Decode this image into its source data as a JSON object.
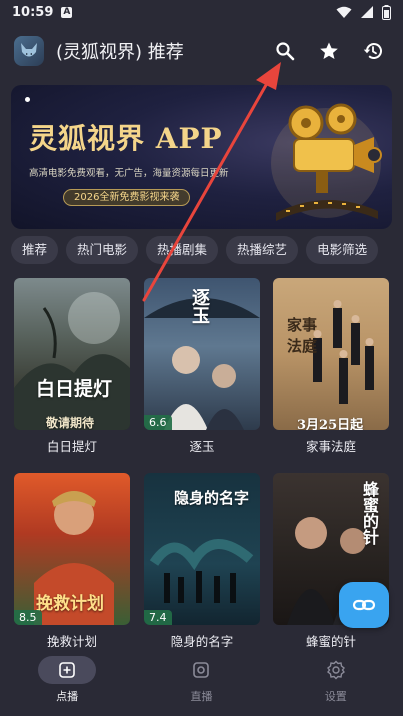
{
  "status_bar": {
    "time": "10:59",
    "app_badge": "A"
  },
  "header": {
    "title": "(灵狐视界) 推荐"
  },
  "banner": {
    "title": "灵狐视界 APP",
    "subtitle": "高清电影免费观看，无广告，海量资源每日更新",
    "tag": "2026全新免费影视来袭"
  },
  "tabs": [
    "推荐",
    "热门电影",
    "热播剧集",
    "热播综艺",
    "电影筛选"
  ],
  "movies": [
    {
      "title": "白日提灯",
      "rating": "",
      "poster_text": "白日提灯",
      "poster_text2": "敬请期待"
    },
    {
      "title": "逐玉",
      "rating": "6.6",
      "poster_text": "逐玉",
      "poster_text2": ""
    },
    {
      "title": "家事法庭",
      "rating": "",
      "poster_text": "家事法庭",
      "poster_text2": "3月25日起"
    },
    {
      "title": "挽救计划",
      "rating": "8.5",
      "poster_text": "挽救计划",
      "poster_text2": ""
    },
    {
      "title": "隐身的名字",
      "rating": "7.4",
      "poster_text": "隐身的名字",
      "poster_text2": ""
    },
    {
      "title": "蜂蜜的针",
      "rating": "",
      "poster_text": "蜂蜜的针",
      "poster_text2": ""
    }
  ],
  "nav": [
    {
      "label": "点播",
      "icon": "plus-square-icon",
      "active": true
    },
    {
      "label": "直播",
      "icon": "live-tv-icon",
      "active": false
    },
    {
      "label": "设置",
      "icon": "gear-icon",
      "active": false
    }
  ],
  "colors": {
    "accent": "#39a4f0",
    "background": "#2a2a36",
    "annotation": "#e8453c",
    "rating_badge": "#236e46"
  }
}
